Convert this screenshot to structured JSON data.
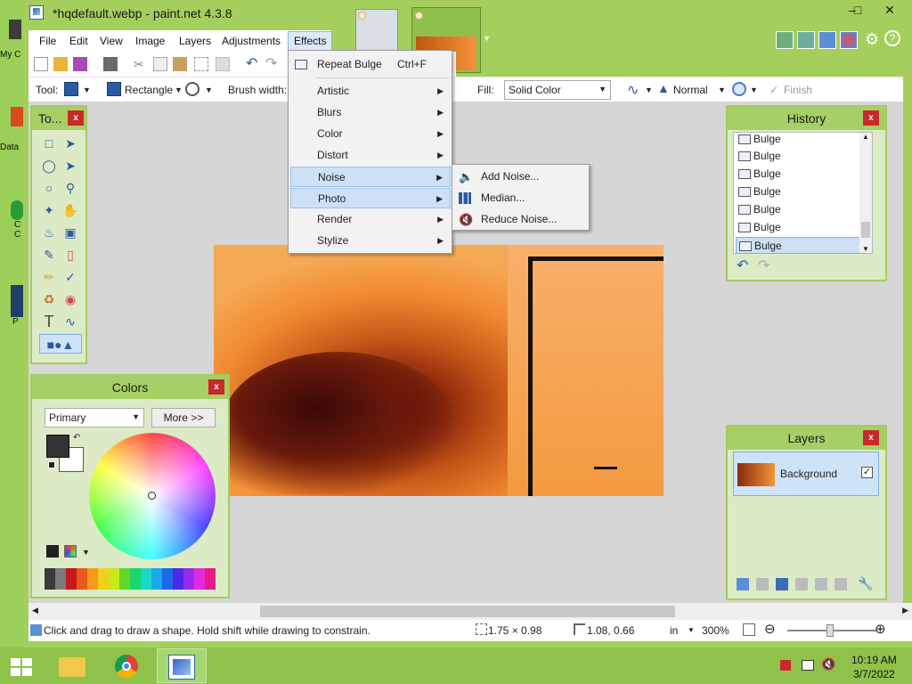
{
  "desktop": {
    "labels": [
      "My C",
      "Data",
      "C",
      "C",
      "P"
    ]
  },
  "window": {
    "title": "*hqdefault.webp - paint.net 4.3.8",
    "minimize": "–",
    "maximize": "□",
    "close": "✕"
  },
  "menubar": {
    "items": [
      "File",
      "Edit",
      "View",
      "Image",
      "Layers",
      "Adjustments",
      "Effects"
    ]
  },
  "toolbar2": {
    "tool_label": "Tool:",
    "shape_label": "Rectangle",
    "brush_label": "Brush width:",
    "fill_label": "Fill:",
    "fill_value": "Solid Color",
    "blend_value": "Normal",
    "finish_label": "Finish"
  },
  "effects_menu": {
    "repeat_label": "Repeat Bulge",
    "repeat_shortcut": "Ctrl+F",
    "items": [
      "Artistic",
      "Blurs",
      "Color",
      "Distort",
      "Noise",
      "Photo",
      "Render",
      "Stylize"
    ]
  },
  "noise_submenu": {
    "items": [
      "Add Noise...",
      "Median...",
      "Reduce Noise..."
    ]
  },
  "tools_panel": {
    "title": "To...",
    "close": "x"
  },
  "colors_panel": {
    "title": "Colors",
    "close": "x",
    "mode": "Primary",
    "more_button": "More >>",
    "palette": [
      "#3a3a3a",
      "#7a7a7a",
      "#c8181e",
      "#e85a1a",
      "#f59a1a",
      "#f2d01a",
      "#c8e81a",
      "#62d82a",
      "#1ad86a",
      "#1ad8c8",
      "#1aa8e8",
      "#1a6ae8",
      "#4a2ae8",
      "#9a2ae8",
      "#e02ae0",
      "#e81a8a"
    ]
  },
  "history_panel": {
    "title": "History",
    "close": "x",
    "items": [
      "Bulge",
      "Bulge",
      "Bulge",
      "Bulge",
      "Bulge",
      "Bulge",
      "Bulge"
    ]
  },
  "layers_panel": {
    "title": "Layers",
    "close": "x",
    "layer_name": "Background"
  },
  "statusbar": {
    "hint": "Click and drag to draw a shape. Hold shift while drawing to constrain.",
    "selection_size": "1.75 × 0.98",
    "cursor_pos": "1.08, 0.66",
    "unit": "in",
    "zoom": "300%"
  },
  "taskbar": {
    "time": "10:19 AM",
    "date": "3/7/2022"
  }
}
